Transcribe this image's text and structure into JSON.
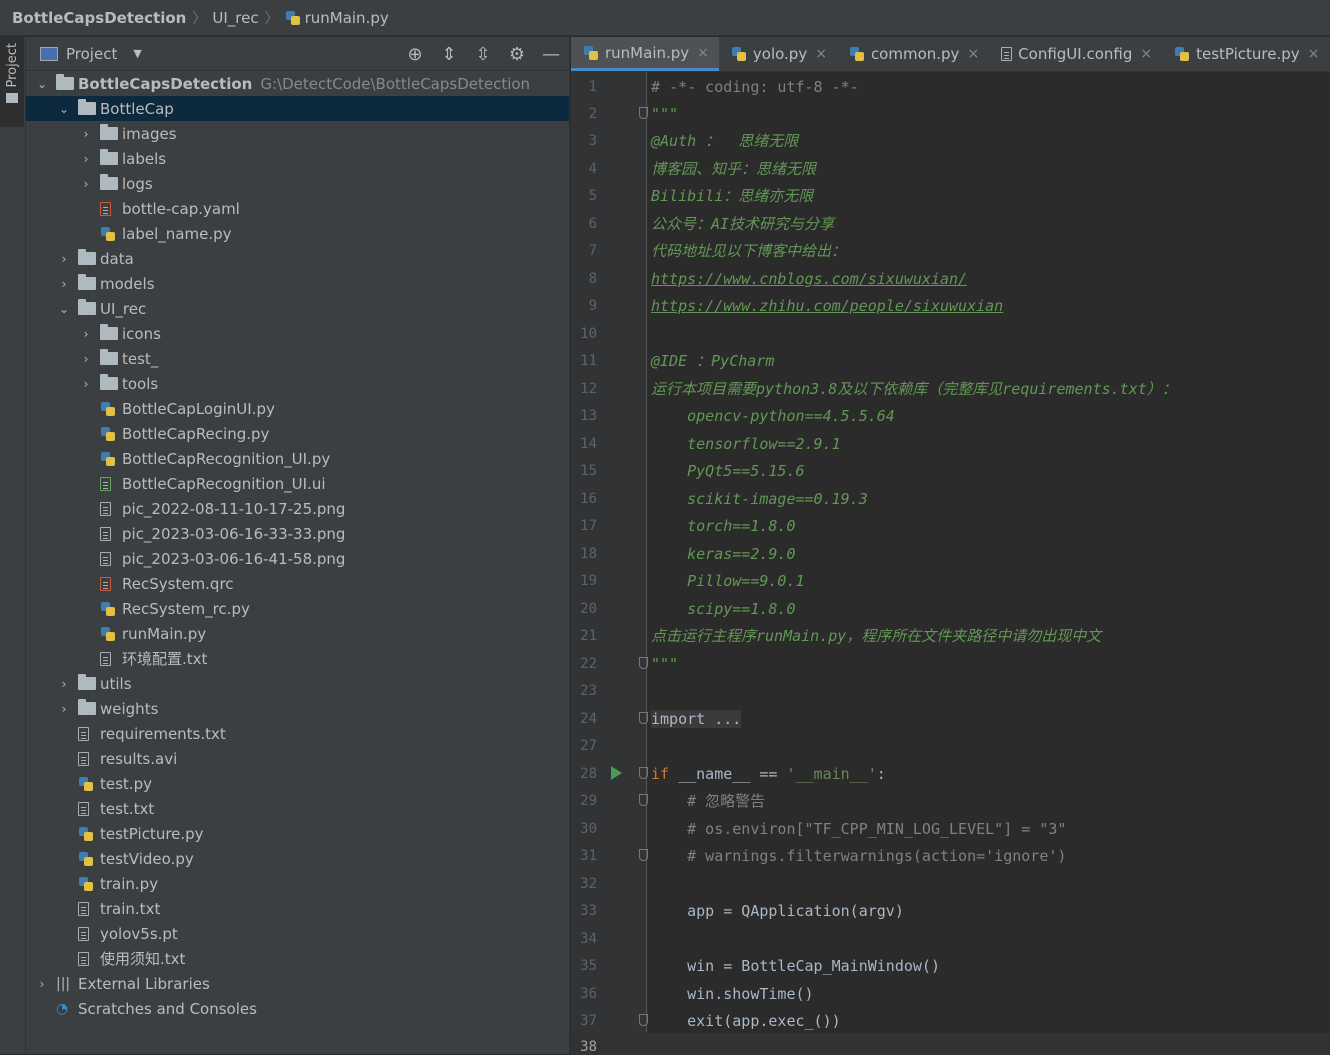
{
  "breadcrumb": {
    "project": "BottleCapsDetection",
    "folder": "UI_rec",
    "file": "runMain.py"
  },
  "strip": {
    "label": "Project"
  },
  "panel": {
    "title": "Project"
  },
  "tree": [
    {
      "label": "BottleCapsDetection",
      "path": "G:\\DetectCode\\BottleCapsDetection",
      "bold": true
    },
    {
      "label": "BottleCap"
    },
    {
      "label": "images"
    },
    {
      "label": "labels"
    },
    {
      "label": "logs"
    },
    {
      "label": "bottle-cap.yaml"
    },
    {
      "label": "label_name.py"
    },
    {
      "label": "data"
    },
    {
      "label": "models"
    },
    {
      "label": "UI_rec"
    },
    {
      "label": "icons"
    },
    {
      "label": "test_"
    },
    {
      "label": "tools"
    },
    {
      "label": "BottleCapLoginUI.py"
    },
    {
      "label": "BottleCapRecing.py"
    },
    {
      "label": "BottleCapRecognition_UI.py"
    },
    {
      "label": "BottleCapRecognition_UI.ui"
    },
    {
      "label": "pic_2022-08-11-10-17-25.png"
    },
    {
      "label": "pic_2023-03-06-16-33-33.png"
    },
    {
      "label": "pic_2023-03-06-16-41-58.png"
    },
    {
      "label": "RecSystem.qrc"
    },
    {
      "label": "RecSystem_rc.py"
    },
    {
      "label": "runMain.py"
    },
    {
      "label": "环境配置.txt"
    },
    {
      "label": "utils"
    },
    {
      "label": "weights"
    },
    {
      "label": "requirements.txt"
    },
    {
      "label": "results.avi"
    },
    {
      "label": "test.py"
    },
    {
      "label": "test.txt"
    },
    {
      "label": "testPicture.py"
    },
    {
      "label": "testVideo.py"
    },
    {
      "label": "train.py"
    },
    {
      "label": "train.txt"
    },
    {
      "label": "yolov5s.pt"
    },
    {
      "label": "使用须知.txt"
    },
    {
      "label": "External Libraries"
    },
    {
      "label": "Scratches and Consoles"
    }
  ],
  "tabs": [
    {
      "label": "runMain.py",
      "active": true
    },
    {
      "label": "yolo.py"
    },
    {
      "label": "common.py"
    },
    {
      "label": "ConfigUI.config"
    },
    {
      "label": "testPicture.py"
    }
  ],
  "code": [
    {
      "n": "1",
      "t": "# -*- coding: utf-8 -*-"
    },
    {
      "n": "2",
      "t": "\"\"\""
    },
    {
      "n": "3",
      "t": "@Auth ：  思绪无限"
    },
    {
      "n": "4",
      "t": "博客园、知乎：思绪无限"
    },
    {
      "n": "5",
      "t": "Bilibili：思绪亦无限"
    },
    {
      "n": "6",
      "t": "公众号：AI技术研究与分享"
    },
    {
      "n": "7",
      "t": "代码地址见以下博客中给出："
    },
    {
      "n": "8",
      "t": "https://www.cnblogs.com/sixuwuxian/"
    },
    {
      "n": "9",
      "t": "https://www.zhihu.com/people/sixuwuxian"
    },
    {
      "n": "10",
      "t": ""
    },
    {
      "n": "11",
      "t": "@IDE ：PyCharm"
    },
    {
      "n": "12",
      "t": "运行本项目需要python3.8及以下依赖库（完整库见requirements.txt）："
    },
    {
      "n": "13",
      "t": "    opencv-python==4.5.5.64"
    },
    {
      "n": "14",
      "t": "    tensorflow==2.9.1"
    },
    {
      "n": "15",
      "t": "    PyQt5==5.15.6"
    },
    {
      "n": "16",
      "t": "    scikit-image==0.19.3"
    },
    {
      "n": "17",
      "t": "    torch==1.8.0"
    },
    {
      "n": "18",
      "t": "    keras==2.9.0"
    },
    {
      "n": "19",
      "t": "    Pillow==9.0.1"
    },
    {
      "n": "20",
      "t": "    scipy==1.8.0"
    },
    {
      "n": "21",
      "t": "点击运行主程序runMain.py，程序所在文件夹路径中请勿出现中文"
    },
    {
      "n": "22",
      "t": "\"\"\""
    },
    {
      "n": "23",
      "t": ""
    },
    {
      "n": "24",
      "t": "import ..."
    },
    {
      "n": "27",
      "t": ""
    },
    {
      "n": "28",
      "t": "if __name__ == '__main__':"
    },
    {
      "n": "29",
      "t": "    # 忽略警告"
    },
    {
      "n": "30",
      "t": "    # os.environ[\"TF_CPP_MIN_LOG_LEVEL\"] = \"3\""
    },
    {
      "n": "31",
      "t": "    # warnings.filterwarnings(action='ignore')"
    },
    {
      "n": "32",
      "t": ""
    },
    {
      "n": "33",
      "t": "    app = QApplication(argv)"
    },
    {
      "n": "34",
      "t": ""
    },
    {
      "n": "35",
      "t": "    win = BottleCap_MainWindow()"
    },
    {
      "n": "36",
      "t": "    win.showTime()"
    },
    {
      "n": "37",
      "t": "    exit(app.exec_())"
    },
    {
      "n": "38",
      "t": ""
    }
  ],
  "code_parts": {
    "if_kw": "if",
    "if_mid": " __name__ == ",
    "if_str": "'__main__'",
    "if_end": ":"
  }
}
